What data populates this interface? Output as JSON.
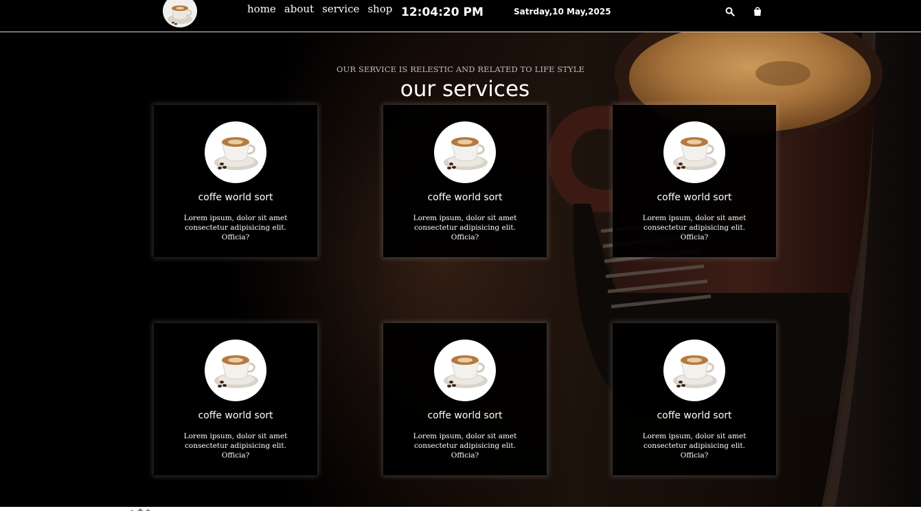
{
  "header": {
    "nav": [
      {
        "label": "home"
      },
      {
        "label": "about"
      },
      {
        "label": "service"
      },
      {
        "label": "shop"
      }
    ],
    "clock": "12:04:20 PM",
    "date": "Satrday,10 May,2025",
    "icons": {
      "search": "search-icon",
      "cart": "shopping-bag-icon",
      "logo": "coffee-cup-logo"
    }
  },
  "services": {
    "subtitle": "OUR SERVICE IS RELESTIC AND RELATED TO LIFE STYLE",
    "title": "our services",
    "cards": [
      {
        "title": "coffe world sort",
        "text": "Lorem ipsum, dolor sit amet consectetur adipisicing elit. Officia?"
      },
      {
        "title": "coffe world sort",
        "text": "Lorem ipsum, dolor sit amet consectetur adipisicing elit. Officia?"
      },
      {
        "title": "coffe world sort",
        "text": "Lorem ipsum, dolor sit amet consectetur adipisicing elit. Officia?"
      },
      {
        "title": "coffe world sort",
        "text": "Lorem ipsum, dolor sit amet consectetur adipisicing elit. Officia?"
      },
      {
        "title": "coffe world sort",
        "text": "Lorem ipsum, dolor sit amet consectetur adipisicing elit. Officia?"
      },
      {
        "title": "coffe world sort",
        "text": "Lorem ipsum, dolor sit amet consectetur adipisicing elit. Officia?"
      }
    ]
  },
  "colors": {
    "background": "#000000",
    "text": "#ffffff",
    "subtitle": "#bdbdbd",
    "coffee": "#b8864e"
  }
}
